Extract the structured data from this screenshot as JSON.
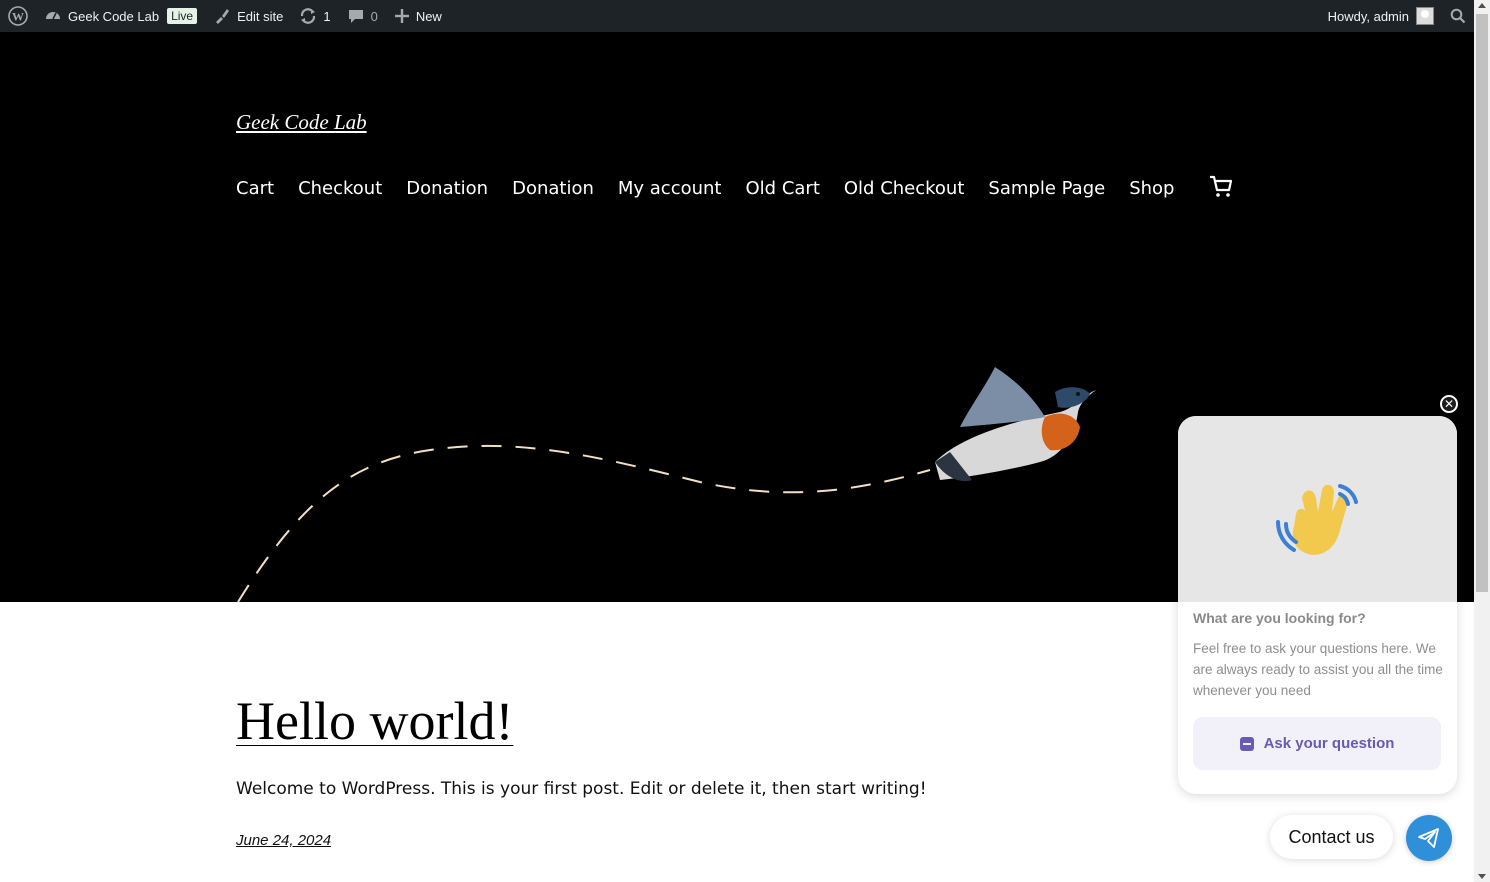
{
  "adminbar": {
    "site_name": "Geek Code Lab",
    "live_badge": "Live",
    "edit_site": "Edit site",
    "updates_count": "1",
    "comments_count": "0",
    "new_label": "New",
    "howdy": "Howdy, admin"
  },
  "site": {
    "title": "Geek Code Lab",
    "nav": [
      "Cart",
      "Checkout",
      "Donation",
      "Donation",
      "My account",
      "Old Cart",
      "Old Checkout",
      "Sample Page",
      "Shop"
    ]
  },
  "post": {
    "title": "Hello world!",
    "excerpt": "Welcome to WordPress. This is your first post. Edit or delete it, then start writing!",
    "date": "June 24, 2024"
  },
  "chat": {
    "heading": "What are you looking for?",
    "body": "Feel free to ask your questions here. We are always ready to assist you all the time whenever you need",
    "ask_button": "Ask your question",
    "contact_label": "Contact us"
  },
  "colors": {
    "adminbar_bg": "#1d2327",
    "hero_bg": "#000000",
    "chat_accent": "#6a5ab2",
    "contact_fab": "#2f8fd8"
  }
}
